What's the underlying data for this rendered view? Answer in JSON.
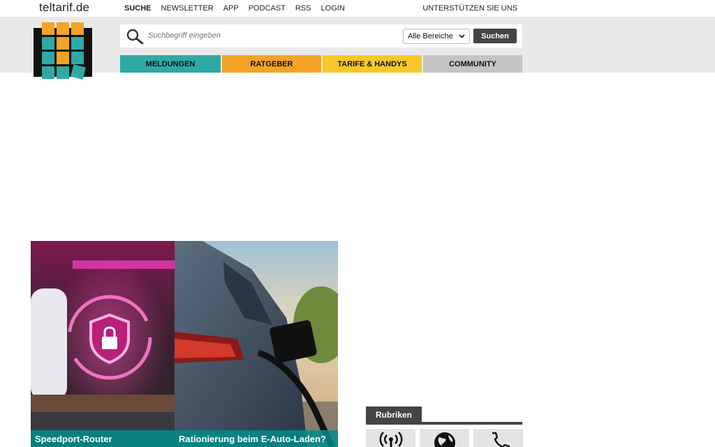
{
  "site": {
    "name": "teltarif.de"
  },
  "topnav": {
    "items": [
      "SUCHE",
      "NEWSLETTER",
      "APP",
      "PODCAST",
      "RSS",
      "LOGIN"
    ],
    "support": "UNTERSTÜTZEN SIE UNS"
  },
  "search": {
    "placeholder": "Suchbegriff eingeben",
    "area_selected": "Alle Bereiche",
    "button": "Suchen"
  },
  "tabs": [
    {
      "label": "MELDUNGEN",
      "color": "#2fa9a6"
    },
    {
      "label": "RATGEBER",
      "color": "#f5a327"
    },
    {
      "label": "TARIFE & HANDYS",
      "color": "#f7c82a"
    },
    {
      "label": "COMMUNITY",
      "color": "#c4c4c4"
    }
  ],
  "articles": [
    {
      "caption": "Speedport-Router"
    },
    {
      "caption": "Rationierung beim E-Auto-Laden?"
    }
  ],
  "sidebar": {
    "title": "Rubriken",
    "icons": [
      "antenna-icon",
      "globe-icon",
      "phone-icon"
    ]
  }
}
